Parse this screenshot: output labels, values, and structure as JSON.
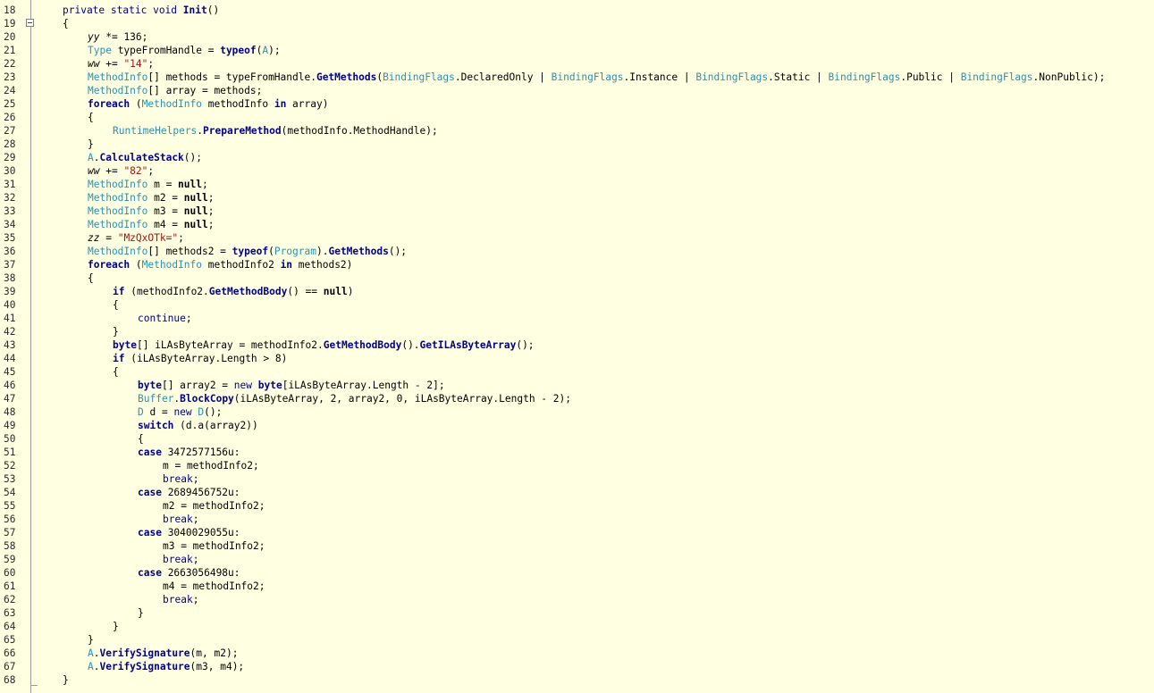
{
  "editor": {
    "first_line_number": 18,
    "lines": [
      {
        "n": "18",
        "indent": 0,
        "tokens": [
          [
            "kw",
            "private"
          ],
          [
            "plain",
            " "
          ],
          [
            "kw",
            "static"
          ],
          [
            "plain",
            " "
          ],
          [
            "kw",
            "void"
          ],
          [
            "plain",
            " "
          ],
          [
            "mth",
            "Init"
          ],
          [
            "plain",
            "()"
          ]
        ]
      },
      {
        "n": "19",
        "indent": 0,
        "tokens": [
          [
            "plain",
            "{"
          ]
        ]
      },
      {
        "n": "20",
        "indent": 1,
        "tokens": [
          [
            "fld",
            "yy"
          ],
          [
            "plain",
            " *= "
          ],
          [
            "num",
            "136"
          ],
          [
            "plain",
            ";"
          ]
        ]
      },
      {
        "n": "21",
        "indent": 1,
        "tokens": [
          [
            "type",
            "Type"
          ],
          [
            "plain",
            " typeFromHandle = "
          ],
          [
            "kwb",
            "typeof"
          ],
          [
            "plain",
            "("
          ],
          [
            "type",
            "A"
          ],
          [
            "plain",
            ");"
          ]
        ]
      },
      {
        "n": "22",
        "indent": 1,
        "tokens": [
          [
            "fld",
            "ww"
          ],
          [
            "plain",
            " += "
          ],
          [
            "str",
            "\"14\""
          ],
          [
            "plain",
            ";"
          ]
        ]
      },
      {
        "n": "23",
        "indent": 1,
        "tokens": [
          [
            "type",
            "MethodInfo"
          ],
          [
            "plain",
            "[] methods = typeFromHandle."
          ],
          [
            "mth",
            "GetMethods"
          ],
          [
            "plain",
            "("
          ],
          [
            "type",
            "BindingFlags"
          ],
          [
            "plain",
            ".DeclaredOnly | "
          ],
          [
            "type",
            "BindingFlags"
          ],
          [
            "plain",
            ".Instance | "
          ],
          [
            "type",
            "BindingFlags"
          ],
          [
            "plain",
            ".Static | "
          ],
          [
            "type",
            "BindingFlags"
          ],
          [
            "plain",
            ".Public | "
          ],
          [
            "type",
            "BindingFlags"
          ],
          [
            "plain",
            ".NonPublic);"
          ]
        ]
      },
      {
        "n": "24",
        "indent": 1,
        "tokens": [
          [
            "type",
            "MethodInfo"
          ],
          [
            "plain",
            "[] array = methods;"
          ]
        ]
      },
      {
        "n": "25",
        "indent": 1,
        "tokens": [
          [
            "kwb",
            "foreach"
          ],
          [
            "plain",
            " ("
          ],
          [
            "type",
            "MethodInfo"
          ],
          [
            "plain",
            " methodInfo "
          ],
          [
            "kwb",
            "in"
          ],
          [
            "plain",
            " array)"
          ]
        ]
      },
      {
        "n": "26",
        "indent": 1,
        "tokens": [
          [
            "plain",
            "{"
          ]
        ]
      },
      {
        "n": "27",
        "indent": 2,
        "tokens": [
          [
            "type",
            "RuntimeHelpers"
          ],
          [
            "plain",
            "."
          ],
          [
            "mth",
            "PrepareMethod"
          ],
          [
            "plain",
            "(methodInfo.MethodHandle);"
          ]
        ]
      },
      {
        "n": "28",
        "indent": 1,
        "tokens": [
          [
            "plain",
            "}"
          ]
        ]
      },
      {
        "n": "29",
        "indent": 1,
        "tokens": [
          [
            "type",
            "A"
          ],
          [
            "plain",
            "."
          ],
          [
            "mth",
            "CalculateStack"
          ],
          [
            "plain",
            "();"
          ]
        ]
      },
      {
        "n": "30",
        "indent": 1,
        "tokens": [
          [
            "fld",
            "ww"
          ],
          [
            "plain",
            " += "
          ],
          [
            "str",
            "\"82\""
          ],
          [
            "plain",
            ";"
          ]
        ]
      },
      {
        "n": "31",
        "indent": 1,
        "tokens": [
          [
            "type",
            "MethodInfo"
          ],
          [
            "plain",
            " m = "
          ],
          [
            "b",
            "null"
          ],
          [
            "plain",
            ";"
          ]
        ]
      },
      {
        "n": "32",
        "indent": 1,
        "tokens": [
          [
            "type",
            "MethodInfo"
          ],
          [
            "plain",
            " m2 = "
          ],
          [
            "b",
            "null"
          ],
          [
            "plain",
            ";"
          ]
        ]
      },
      {
        "n": "33",
        "indent": 1,
        "tokens": [
          [
            "type",
            "MethodInfo"
          ],
          [
            "plain",
            " m3 = "
          ],
          [
            "b",
            "null"
          ],
          [
            "plain",
            ";"
          ]
        ]
      },
      {
        "n": "34",
        "indent": 1,
        "tokens": [
          [
            "type",
            "MethodInfo"
          ],
          [
            "plain",
            " m4 = "
          ],
          [
            "b",
            "null"
          ],
          [
            "plain",
            ";"
          ]
        ]
      },
      {
        "n": "35",
        "indent": 1,
        "tokens": [
          [
            "fld",
            "zz"
          ],
          [
            "plain",
            " = "
          ],
          [
            "str",
            "\"MzQxOTk=\""
          ],
          [
            "plain",
            ";"
          ]
        ]
      },
      {
        "n": "36",
        "indent": 1,
        "tokens": [
          [
            "type",
            "MethodInfo"
          ],
          [
            "plain",
            "[] methods2 = "
          ],
          [
            "kwb",
            "typeof"
          ],
          [
            "plain",
            "("
          ],
          [
            "type",
            "Program"
          ],
          [
            "plain",
            ")."
          ],
          [
            "mth",
            "GetMethods"
          ],
          [
            "plain",
            "();"
          ]
        ]
      },
      {
        "n": "37",
        "indent": 1,
        "tokens": [
          [
            "kwb",
            "foreach"
          ],
          [
            "plain",
            " ("
          ],
          [
            "type",
            "MethodInfo"
          ],
          [
            "plain",
            " methodInfo2 "
          ],
          [
            "kwb",
            "in"
          ],
          [
            "plain",
            " methods2)"
          ]
        ]
      },
      {
        "n": "38",
        "indent": 1,
        "tokens": [
          [
            "plain",
            "{"
          ]
        ]
      },
      {
        "n": "39",
        "indent": 2,
        "tokens": [
          [
            "kwb",
            "if"
          ],
          [
            "plain",
            " (methodInfo2."
          ],
          [
            "mth",
            "GetMethodBody"
          ],
          [
            "plain",
            "() == "
          ],
          [
            "b",
            "null"
          ],
          [
            "plain",
            ")"
          ]
        ]
      },
      {
        "n": "40",
        "indent": 2,
        "tokens": [
          [
            "plain",
            "{"
          ]
        ]
      },
      {
        "n": "41",
        "indent": 3,
        "tokens": [
          [
            "kw",
            "continue"
          ],
          [
            "plain",
            ";"
          ]
        ]
      },
      {
        "n": "42",
        "indent": 2,
        "tokens": [
          [
            "plain",
            "}"
          ]
        ]
      },
      {
        "n": "43",
        "indent": 2,
        "tokens": [
          [
            "kwb",
            "byte"
          ],
          [
            "plain",
            "[] iLAsByteArray = methodInfo2."
          ],
          [
            "mth",
            "GetMethodBody"
          ],
          [
            "plain",
            "()."
          ],
          [
            "mth",
            "GetILAsByteArray"
          ],
          [
            "plain",
            "();"
          ]
        ]
      },
      {
        "n": "44",
        "indent": 2,
        "tokens": [
          [
            "kwb",
            "if"
          ],
          [
            "plain",
            " (iLAsByteArray.Length > 8)"
          ]
        ]
      },
      {
        "n": "45",
        "indent": 2,
        "tokens": [
          [
            "plain",
            "{"
          ]
        ]
      },
      {
        "n": "46",
        "indent": 3,
        "tokens": [
          [
            "kwb",
            "byte"
          ],
          [
            "plain",
            "[] array2 = "
          ],
          [
            "kw",
            "new"
          ],
          [
            "plain",
            " "
          ],
          [
            "kwb",
            "byte"
          ],
          [
            "plain",
            "[iLAsByteArray.Length - 2];"
          ]
        ]
      },
      {
        "n": "47",
        "indent": 3,
        "tokens": [
          [
            "type",
            "Buffer"
          ],
          [
            "plain",
            "."
          ],
          [
            "mth",
            "BlockCopy"
          ],
          [
            "plain",
            "(iLAsByteArray, 2, array2, 0, iLAsByteArray.Length - 2);"
          ]
        ]
      },
      {
        "n": "48",
        "indent": 3,
        "tokens": [
          [
            "type",
            "D"
          ],
          [
            "plain",
            " d = "
          ],
          [
            "kw",
            "new"
          ],
          [
            "plain",
            " "
          ],
          [
            "type",
            "D"
          ],
          [
            "plain",
            "();"
          ]
        ]
      },
      {
        "n": "49",
        "indent": 3,
        "tokens": [
          [
            "kwb",
            "switch"
          ],
          [
            "plain",
            " (d.a(array2))"
          ]
        ]
      },
      {
        "n": "50",
        "indent": 3,
        "tokens": [
          [
            "plain",
            "{"
          ]
        ]
      },
      {
        "n": "51",
        "indent": 3,
        "tokens": [
          [
            "kwb",
            "case"
          ],
          [
            "plain",
            " 3472577156u:"
          ]
        ]
      },
      {
        "n": "52",
        "indent": 4,
        "tokens": [
          [
            "plain",
            "m = methodInfo2;"
          ]
        ]
      },
      {
        "n": "53",
        "indent": 4,
        "tokens": [
          [
            "kw",
            "break"
          ],
          [
            "plain",
            ";"
          ]
        ]
      },
      {
        "n": "54",
        "indent": 3,
        "tokens": [
          [
            "kwb",
            "case"
          ],
          [
            "plain",
            " 2689456752u:"
          ]
        ]
      },
      {
        "n": "55",
        "indent": 4,
        "tokens": [
          [
            "plain",
            "m2 = methodInfo2;"
          ]
        ]
      },
      {
        "n": "56",
        "indent": 4,
        "tokens": [
          [
            "kw",
            "break"
          ],
          [
            "plain",
            ";"
          ]
        ]
      },
      {
        "n": "57",
        "indent": 3,
        "tokens": [
          [
            "kwb",
            "case"
          ],
          [
            "plain",
            " 3040029055u:"
          ]
        ]
      },
      {
        "n": "58",
        "indent": 4,
        "tokens": [
          [
            "plain",
            "m3 = methodInfo2;"
          ]
        ]
      },
      {
        "n": "59",
        "indent": 4,
        "tokens": [
          [
            "kw",
            "break"
          ],
          [
            "plain",
            ";"
          ]
        ]
      },
      {
        "n": "60",
        "indent": 3,
        "tokens": [
          [
            "kwb",
            "case"
          ],
          [
            "plain",
            " 2663056498u:"
          ]
        ]
      },
      {
        "n": "61",
        "indent": 4,
        "tokens": [
          [
            "plain",
            "m4 = methodInfo2;"
          ]
        ]
      },
      {
        "n": "62",
        "indent": 4,
        "tokens": [
          [
            "kw",
            "break"
          ],
          [
            "plain",
            ";"
          ]
        ]
      },
      {
        "n": "63",
        "indent": 3,
        "tokens": [
          [
            "plain",
            "}"
          ]
        ]
      },
      {
        "n": "64",
        "indent": 2,
        "tokens": [
          [
            "plain",
            "}"
          ]
        ]
      },
      {
        "n": "65",
        "indent": 1,
        "tokens": [
          [
            "plain",
            "}"
          ]
        ]
      },
      {
        "n": "66",
        "indent": 1,
        "tokens": [
          [
            "type",
            "A"
          ],
          [
            "plain",
            "."
          ],
          [
            "mth",
            "VerifySignature"
          ],
          [
            "plain",
            "(m, m2);"
          ]
        ]
      },
      {
        "n": "67",
        "indent": 1,
        "tokens": [
          [
            "type",
            "A"
          ],
          [
            "plain",
            "."
          ],
          [
            "mth",
            "VerifySignature"
          ],
          [
            "plain",
            "(m3, m4);"
          ]
        ]
      },
      {
        "n": "68",
        "indent": 0,
        "tokens": [
          [
            "plain",
            "}"
          ]
        ]
      }
    ]
  },
  "colors": {
    "background": "#ffffe1",
    "keyword": "#00008b",
    "type": "#2b91af",
    "string": "#a31515"
  }
}
